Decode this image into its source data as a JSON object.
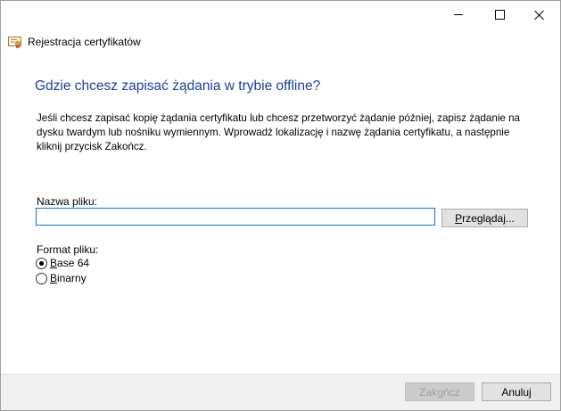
{
  "window": {
    "caption_buttons": {
      "minimize_icon": "minimize-icon",
      "maximize_icon": "maximize-icon",
      "close_icon": "close-icon"
    }
  },
  "wizard": {
    "title": "Rejestracja certyfikatów",
    "icon": "certificate-icon"
  },
  "page": {
    "heading": "Gdzie chcesz zapisać żądania w trybie offline?",
    "description": "Jeśli chcesz zapisać kopię żądania certyfikatu lub chcesz przetworzyć żądanie później, zapisz żądanie na dysku twardym lub nośniku wymiennym. Wprowadź lokalizację i nazwę żądania certyfikatu, a następnie kliknij przycisk Zakończ.",
    "file_name_label": "Nazwa pliku:",
    "file_name_value": "",
    "browse_label_pre": "",
    "browse_label_ul": "P",
    "browse_label_post": "rzeglądaj...",
    "format_label": "Format pliku:",
    "formats": [
      {
        "pre": "",
        "ul": "B",
        "post": "ase 64",
        "selected": true
      },
      {
        "pre": "",
        "ul": "B",
        "post": "inarny",
        "selected": false
      }
    ]
  },
  "footer": {
    "finish_pre": "Zak",
    "finish_ul": "o",
    "finish_post": "ńcz",
    "finish_enabled": false,
    "cancel_label": "Anuluj"
  },
  "colors": {
    "heading": "#1a3e9e",
    "input_border_focus": "#0078d7",
    "footer_bg": "#f0f0f0"
  }
}
